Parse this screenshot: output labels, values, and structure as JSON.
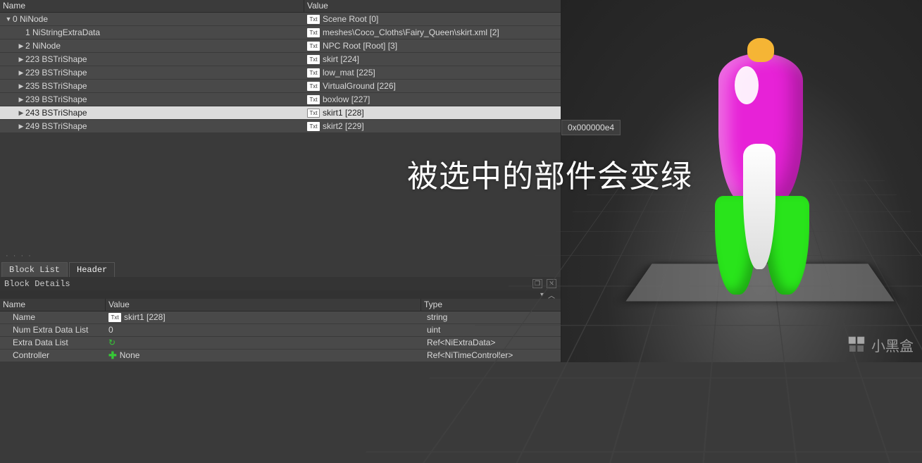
{
  "headers": {
    "name": "Name",
    "value": "Value"
  },
  "tree": [
    {
      "indent": 0,
      "arrow": "▼",
      "name": "0 NiNode",
      "valIcon": "Txt",
      "value": "Scene Root [0]",
      "sel": false
    },
    {
      "indent": 1,
      "arrow": "",
      "name": "1 NiStringExtraData",
      "valIcon": "Txt",
      "value": "meshes\\Coco_Cloths\\Fairy_Queen\\skirt.xml [2]",
      "sel": false
    },
    {
      "indent": 1,
      "arrow": "▶",
      "name": "2 NiNode",
      "valIcon": "Txt",
      "value": "NPC Root [Root] [3]",
      "sel": false
    },
    {
      "indent": 1,
      "arrow": "▶",
      "name": "223 BSTriShape",
      "valIcon": "Txt",
      "value": "skirt [224]",
      "sel": false
    },
    {
      "indent": 1,
      "arrow": "▶",
      "name": "229 BSTriShape",
      "valIcon": "Txt",
      "value": "low_mat [225]",
      "sel": false
    },
    {
      "indent": 1,
      "arrow": "▶",
      "name": "235 BSTriShape",
      "valIcon": "Txt",
      "value": "VirtualGround [226]",
      "sel": false
    },
    {
      "indent": 1,
      "arrow": "▶",
      "name": "239 BSTriShape",
      "valIcon": "Txt",
      "value": "boxlow [227]",
      "sel": false
    },
    {
      "indent": 1,
      "arrow": "▶",
      "name": "243 BSTriShape",
      "valIcon": "Txt",
      "value": "skirt1 [228]",
      "sel": true
    },
    {
      "indent": 1,
      "arrow": "▶",
      "name": "249 BSTriShape",
      "valIcon": "Txt",
      "value": "skirt2 [229]",
      "sel": false
    }
  ],
  "tabs": {
    "blockList": "Block List",
    "header": "Header"
  },
  "detailsTitle": "Block Details",
  "detailsHeaders": {
    "name": "Name",
    "value": "Value",
    "type": "Type"
  },
  "details": [
    {
      "name": "Name",
      "valueIcon": "txt",
      "value": "skirt1 [228]",
      "type": "string"
    },
    {
      "name": "Num Extra Data List",
      "valueIcon": "",
      "value": "0",
      "type": "uint"
    },
    {
      "name": "Extra Data List",
      "valueIcon": "refresh",
      "value": "",
      "type": "Ref<NiExtraData>"
    },
    {
      "name": "Controller",
      "valueIcon": "plus",
      "value": "None",
      "type": "Ref<NiTimeController>"
    }
  ],
  "tooltip": "0x000000e4",
  "overlay": "被选中的部件会变绿",
  "watermark": "小黑盒"
}
